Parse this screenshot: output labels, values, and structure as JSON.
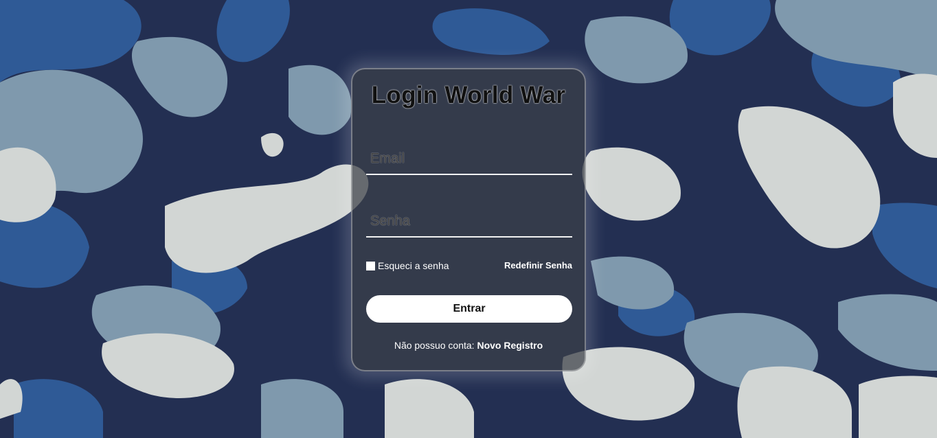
{
  "background": {
    "pattern": "camouflage",
    "colors": {
      "navy": "#232f52",
      "blue": "#2f5a96",
      "grey_blue": "#7f99ad",
      "light_grey": "#d2d6d4"
    }
  },
  "login": {
    "title": "Login World War",
    "email_placeholder": "Email",
    "password_placeholder": "Senha",
    "remember_label": "Esqueci a senha",
    "reset_link": "Redefinir Senha",
    "submit_label": "Entrar",
    "register_prompt": "Não possuo conta:",
    "register_link": "Novo Registro"
  }
}
